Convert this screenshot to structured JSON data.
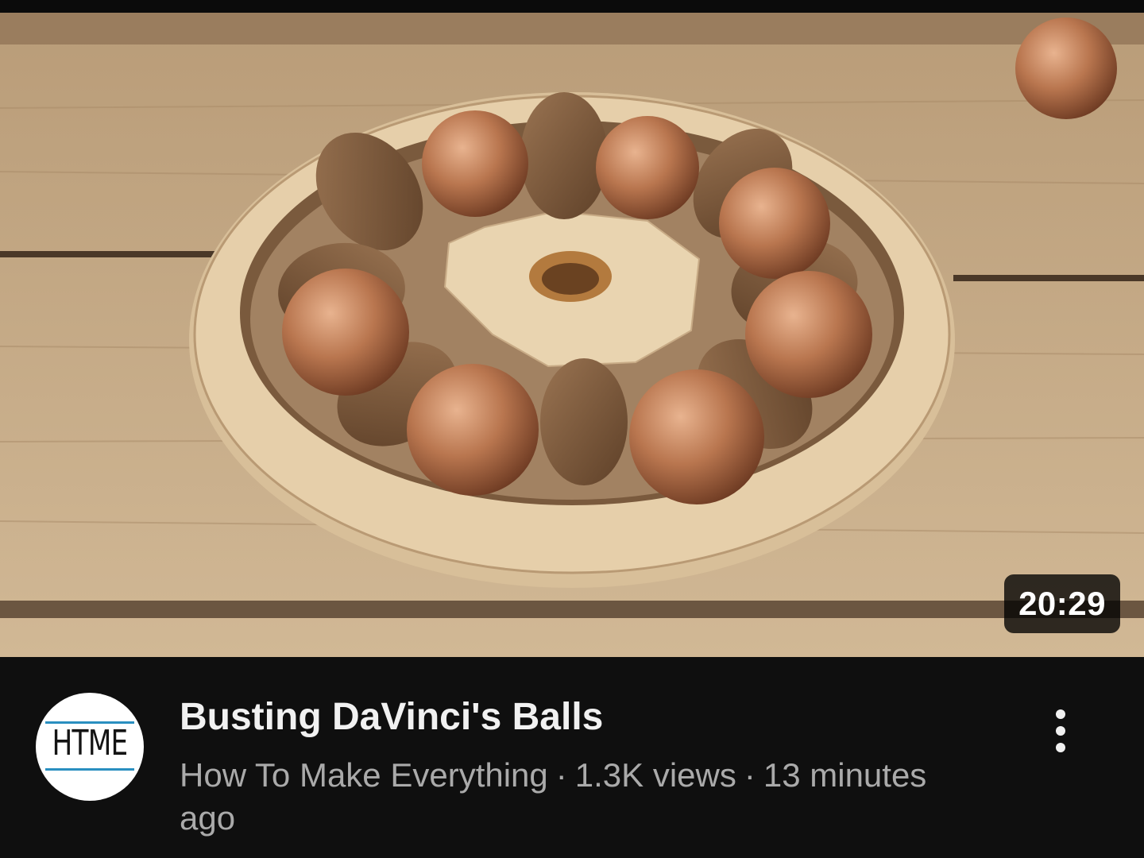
{
  "video": {
    "title": "Busting DaVinci's Balls",
    "duration": "20:29",
    "channel": "How To Make Everything",
    "separator": "·",
    "views": "1.3K views",
    "age": "13 minutes ago"
  },
  "channel_avatar": {
    "logo_text": "HTME",
    "accent_color": "#2a8fc0"
  },
  "menu": {
    "icon": "more-vert-icon"
  },
  "colors": {
    "background": "#0f0f0f",
    "title_text": "#f1f1f1",
    "secondary_text": "#aaaaaa"
  }
}
